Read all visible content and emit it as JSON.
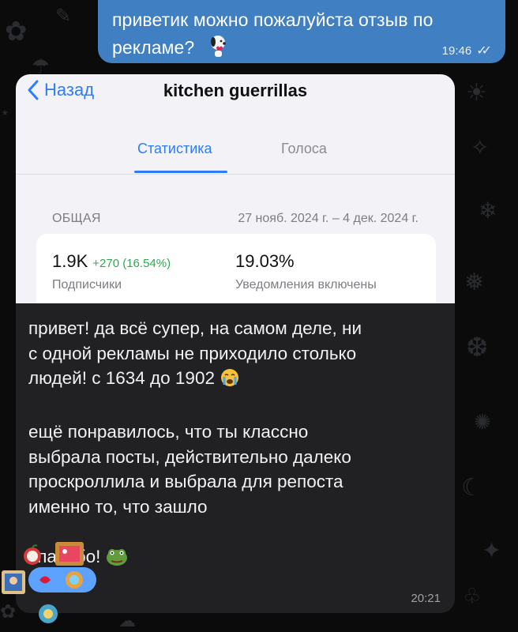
{
  "outgoing_message": {
    "text_line1": "приветик можно пожалуйста отзыв по",
    "text_line2": "рекламе?",
    "time": "19:46",
    "status_icon": "double-check-icon"
  },
  "incoming_message": {
    "screenshot": {
      "back_label": "Назад",
      "channel_title": "kitchen guerrillas",
      "tabs": [
        {
          "label": "Статистика",
          "active": true
        },
        {
          "label": "Голоса",
          "active": false
        }
      ],
      "section_label": "ОБЩАЯ",
      "date_range": "27 нояб. 2024 г. – 4 дек. 2024 г.",
      "stats": [
        {
          "value": "1.9K",
          "delta": "+270 (16.54%)",
          "label": "Подписчики"
        },
        {
          "value": "19.03%",
          "delta": "",
          "label": "Уведомления включены"
        }
      ]
    },
    "lines": [
      "привет! да всё супер, на самом деле, ни",
      "с одной рекламы не приходило столько",
      "людей! с 1634 до 1902",
      "ещё понравилось, что ты классно",
      "выбрала посты, действительно далеко",
      "проскроллила и выбрала для репоста",
      "именно то, что зашло",
      "спасибо!"
    ],
    "time": "20:21"
  },
  "colors": {
    "outgoing_bubble": "#3f7fc2",
    "incoming_bubble": "#212124",
    "accent_blue": "#2f7cf6",
    "positive_green": "#34a853",
    "background": "#0b0b0c"
  }
}
